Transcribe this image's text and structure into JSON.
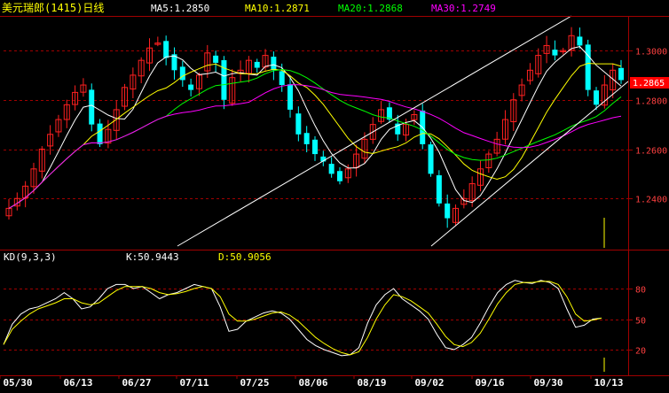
{
  "header": {
    "title": "美元瑞郎(1415)日线",
    "ma_labels": [
      {
        "text": "MA5:1.2850",
        "color": "#ffffff"
      },
      {
        "text": "MA10:1.2871",
        "color": "#ffff00"
      },
      {
        "text": "MA20:1.2868",
        "color": "#00ff00"
      },
      {
        "text": "MA30:1.2749",
        "color": "#ff00ff"
      }
    ]
  },
  "kd": {
    "label": "KD(9,3,3)",
    "k_label": "K:50.9443",
    "d_label": "D:50.9056",
    "ticks": [
      "80",
      "50",
      "20"
    ]
  },
  "price_ticks": [
    "1.2865",
    "1.3000",
    "1.2800",
    "1.2600",
    "1.2400"
  ],
  "date_ticks": [
    "05/30",
    "06/13",
    "06/27",
    "07/11",
    "07/25",
    "08/06",
    "08/19",
    "09/02",
    "09/16",
    "09/30",
    "10/13"
  ],
  "colors": {
    "up": "#ff2020",
    "down": "#00ffff",
    "ma5": "#ffffff",
    "ma10": "#ffff00",
    "ma20": "#00ff00",
    "ma30": "#ff00ff",
    "k": "#ffffff",
    "d": "#ffff00",
    "grid": "#a00000",
    "axis": "#a00000"
  },
  "chart_data": {
    "type": "candlestick",
    "symbol": "美元瑞郎(1415)",
    "period": "日线",
    "price_range": [
      1.22,
      1.314
    ],
    "kd_range": [
      0,
      100
    ],
    "dates": [
      "05/30",
      "06/13",
      "06/27",
      "07/11",
      "07/25",
      "08/06",
      "08/19",
      "09/02",
      "09/16",
      "09/30",
      "10/13"
    ],
    "close": [
      1.236,
      1.24,
      1.245,
      1.252,
      1.26,
      1.266,
      1.272,
      1.278,
      1.283,
      1.286,
      1.27,
      1.262,
      1.268,
      1.276,
      1.285,
      1.29,
      1.296,
      1.301,
      1.303,
      1.297,
      1.292,
      1.288,
      1.284,
      1.29,
      1.299,
      1.295,
      1.28,
      1.289,
      1.292,
      1.296,
      1.293,
      1.298,
      1.292,
      1.286,
      1.276,
      1.266,
      1.262,
      1.258,
      1.255,
      1.25,
      1.247,
      1.252,
      1.258,
      1.264,
      1.27,
      1.276,
      1.272,
      1.266,
      1.27,
      1.274,
      1.262,
      1.25,
      1.238,
      1.232,
      1.236,
      1.24,
      1.246,
      1.252,
      1.258,
      1.264,
      1.272,
      1.28,
      1.286,
      1.292,
      1.298,
      1.302,
      1.298,
      1.3,
      1.306,
      1.302,
      1.284,
      1.278,
      1.286,
      1.292,
      1.288
    ],
    "kd_k": [
      25,
      45,
      55,
      60,
      62,
      66,
      70,
      76,
      70,
      60,
      62,
      70,
      80,
      84,
      84,
      80,
      82,
      76,
      70,
      74,
      76,
      80,
      84,
      82,
      80,
      62,
      38,
      40,
      48,
      52,
      56,
      58,
      56,
      50,
      40,
      30,
      24,
      20,
      17,
      14,
      15,
      22,
      46,
      64,
      74,
      80,
      70,
      64,
      58,
      50,
      35,
      22,
      20,
      25,
      32,
      46,
      62,
      76,
      84,
      88,
      86,
      85,
      88,
      86,
      80,
      60,
      42,
      44,
      50,
      51
    ],
    "kd_d": [
      25,
      40,
      48,
      55,
      60,
      63,
      66,
      70,
      70,
      66,
      64,
      66,
      72,
      78,
      82,
      82,
      82,
      80,
      76,
      74,
      75,
      77,
      80,
      82,
      80,
      72,
      55,
      48,
      48,
      50,
      53,
      56,
      57,
      54,
      48,
      40,
      32,
      26,
      21,
      17,
      15,
      18,
      32,
      50,
      64,
      74,
      72,
      68,
      62,
      56,
      45,
      33,
      25,
      23,
      27,
      36,
      50,
      65,
      76,
      84,
      86,
      86,
      87,
      87,
      84,
      72,
      55,
      48,
      49,
      51
    ]
  }
}
